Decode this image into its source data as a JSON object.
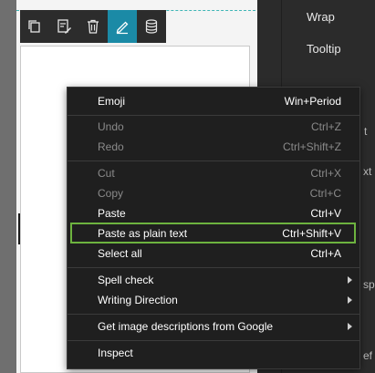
{
  "toolbar": {
    "buttons": [
      {
        "name": "copy-icon",
        "active": false
      },
      {
        "name": "rename-icon",
        "active": false
      },
      {
        "name": "trash-icon",
        "active": false
      },
      {
        "name": "pen-icon",
        "active": true
      },
      {
        "name": "database-icon",
        "active": false
      }
    ],
    "active_color": "#1b8aa6"
  },
  "properties_panel": {
    "wrap_label": "Wrap",
    "tooltip_label": "Tooltip",
    "fragments": [
      "t",
      "xt",
      "sp",
      "ef"
    ]
  },
  "context_menu": {
    "emoji": {
      "label": "Emoji",
      "shortcut": "Win+Period"
    },
    "undo": {
      "label": "Undo",
      "shortcut": "Ctrl+Z"
    },
    "redo": {
      "label": "Redo",
      "shortcut": "Ctrl+Shift+Z"
    },
    "cut": {
      "label": "Cut",
      "shortcut": "Ctrl+X"
    },
    "copy": {
      "label": "Copy",
      "shortcut": "Ctrl+C"
    },
    "paste": {
      "label": "Paste",
      "shortcut": "Ctrl+V"
    },
    "paste_plain": {
      "label": "Paste as plain text",
      "shortcut": "Ctrl+Shift+V"
    },
    "select_all": {
      "label": "Select all",
      "shortcut": "Ctrl+A"
    },
    "spell_check": {
      "label": "Spell check"
    },
    "writing_direction": {
      "label": "Writing Direction"
    },
    "image_descriptions": {
      "label": "Get image descriptions from Google"
    },
    "inspect": {
      "label": "Inspect"
    },
    "highlight_color": "#6db33f"
  }
}
